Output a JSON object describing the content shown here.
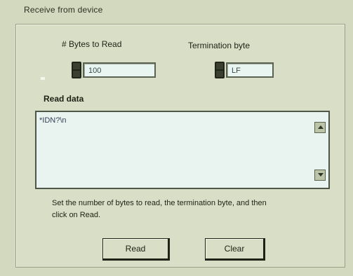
{
  "window": {
    "title": "Receive from device"
  },
  "inputs": {
    "bytes_label": "# Bytes to Read",
    "bytes_value": "100",
    "termination_label": "Termination byte",
    "termination_value": "LF"
  },
  "read_data": {
    "label": "Read data",
    "content": "*IDN?\\n"
  },
  "help_text": "Set the number of bytes to read, the termination byte, and then click on Read.",
  "buttons": {
    "read": "Read",
    "clear": "Clear"
  },
  "colors": {
    "window_bg": "#d6dcc4",
    "field_bg": "#e8f5f1"
  }
}
